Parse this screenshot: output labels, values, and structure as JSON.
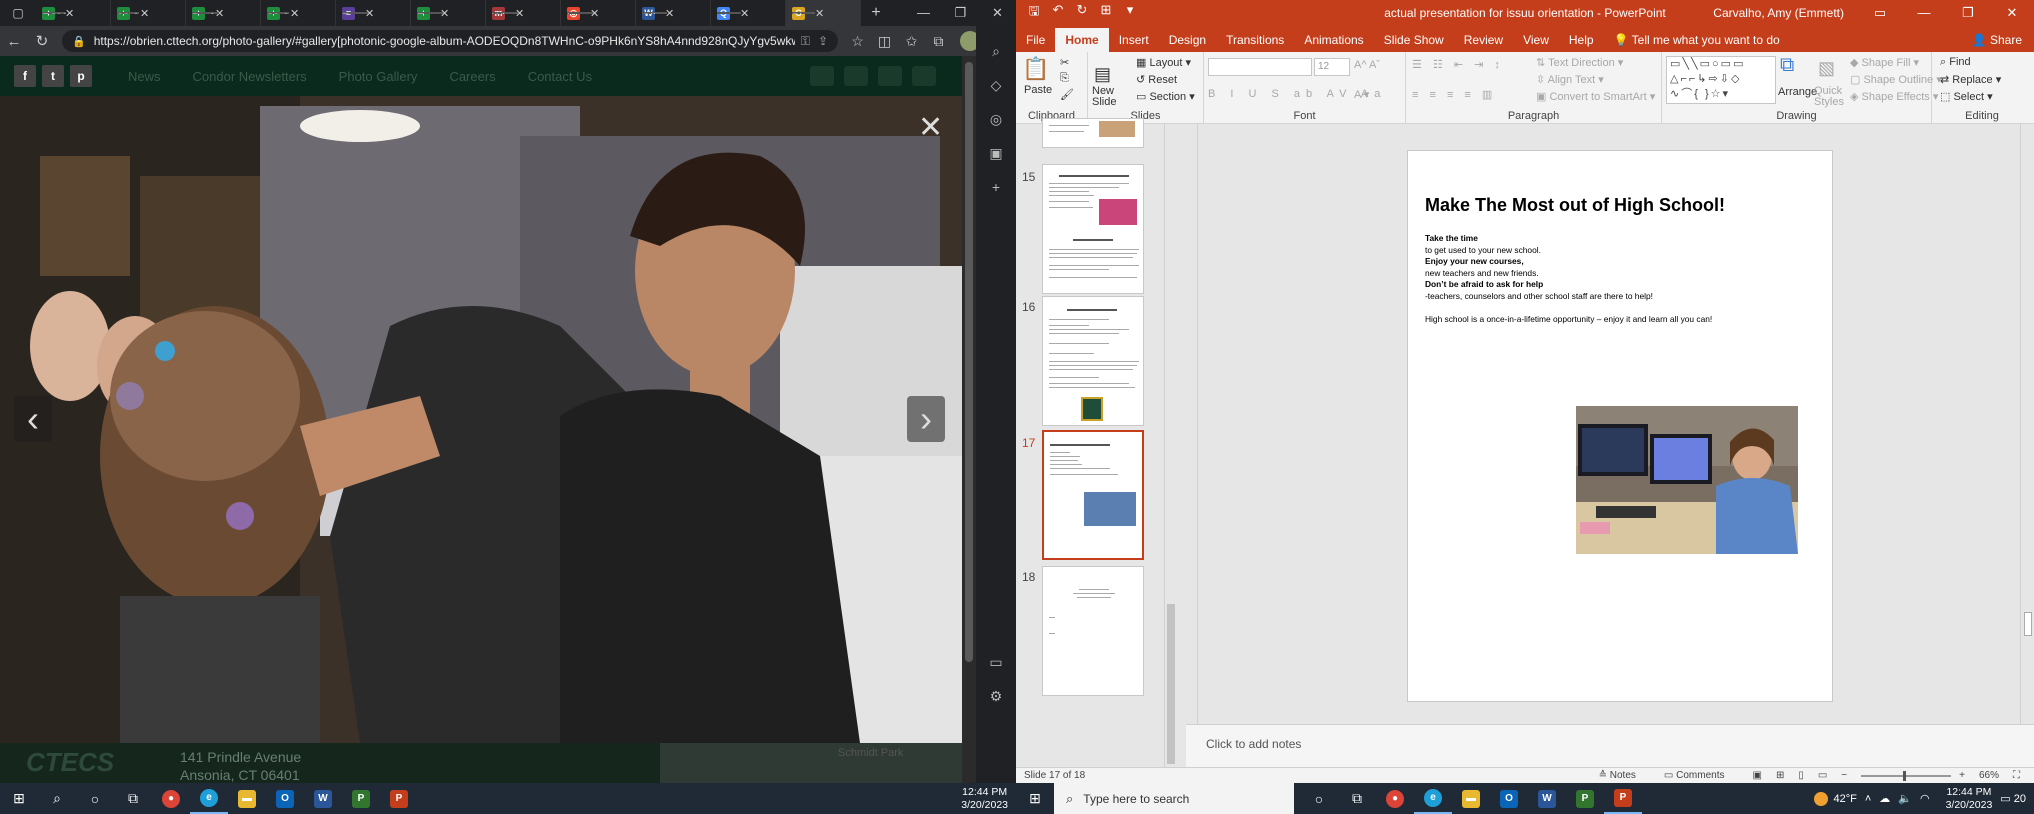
{
  "browser": {
    "tabs": [
      {
        "label": "ECM",
        "fav_color": "#1e8e3e",
        "fav_glyph": "+"
      },
      {
        "label": "22-2",
        "fav_color": "#1e8e3e",
        "fav_glyph": "+"
      },
      {
        "label": "Basic",
        "fav_color": "#1e8e3e",
        "fav_glyph": "+"
      },
      {
        "label": "23-2",
        "fav_color": "#1e8e3e",
        "fav_glyph": "+"
      },
      {
        "label": "Emm",
        "fav_color": "#5a3f9a",
        "fav_glyph": "≡"
      },
      {
        "label": "Emm",
        "fav_color": "#1e8e3e",
        "fav_glyph": "+"
      },
      {
        "label": "What",
        "fav_color": "#a4373a",
        "fav_glyph": "m"
      },
      {
        "label": "Issuu",
        "fav_color": "#e8452c",
        "fav_glyph": "◎"
      },
      {
        "label": "Olive",
        "fav_color": "#2b5797",
        "fav_glyph": "W"
      },
      {
        "label": "emm",
        "fav_color": "#4285f4",
        "fav_glyph": "Q"
      },
      {
        "label": "Phot",
        "fav_color": "#d9a520",
        "fav_glyph": "C"
      }
    ],
    "url": "https://obrien.cttech.org/photo-gallery/#gallery[photonic-google-album-AODEOQDn8TWHnC-o9PHk6nYS8hA4nnd928nQJyYgv5wkwTQa...",
    "site": {
      "nav": [
        "News",
        "Condor Newsletters",
        "Photo Gallery",
        "Careers",
        "Contact Us"
      ],
      "social": [
        "f",
        "t",
        "p"
      ],
      "footer_logo": "CTECS",
      "footer_address_line1": "141 Prindle Avenue",
      "footer_address_line2": "Ansonia, CT 06401",
      "map_label": "Schmidt Park"
    }
  },
  "ppt": {
    "window_title": "actual presentation for issuu orientation  -  PowerPoint",
    "user": "Carvalho, Amy (Emmett)",
    "tabs": [
      "File",
      "Home",
      "Insert",
      "Design",
      "Transitions",
      "Animations",
      "Slide Show",
      "Review",
      "View",
      "Help"
    ],
    "active_tab": "Home",
    "tell_me": "Tell me what you want to do",
    "share": "Share",
    "ribbon": {
      "clipboard": {
        "label": "Clipboard",
        "paste": "Paste"
      },
      "slides": {
        "label": "Slides",
        "new_slide": "New Slide",
        "layout": "Layout",
        "reset": "Reset",
        "section": "Section"
      },
      "font": {
        "label": "Font",
        "size": "12"
      },
      "paragraph": {
        "label": "Paragraph",
        "text_direction": "Text Direction",
        "align_text": "Align Text",
        "convert": "Convert to SmartArt"
      },
      "drawing": {
        "label": "Drawing",
        "arrange": "Arrange",
        "quick_styles": "Quick Styles",
        "shape_fill": "Shape Fill",
        "shape_outline": "Shape Outline",
        "shape_effects": "Shape Effects"
      },
      "editing": {
        "label": "Editing",
        "find": "Find",
        "replace": "Replace",
        "select": "Select"
      }
    },
    "thumbnails": [
      {
        "num": "15",
        "selected": false
      },
      {
        "num": "16",
        "selected": false
      },
      {
        "num": "17",
        "selected": true
      },
      {
        "num": "18",
        "selected": false
      }
    ],
    "slide": {
      "title": "Make The Most out of High School!",
      "lines": [
        {
          "text": "Take the time",
          "bold": true
        },
        {
          "text": "to get used to your new school.",
          "bold": false
        },
        {
          "text": "Enjoy your new courses,",
          "bold": true
        },
        {
          "text": "new teachers and new friends.",
          "bold": false
        },
        {
          "text": "Don’t be afraid to ask for help",
          "bold": true
        },
        {
          "text": "-teachers, counselors and other school staff are there to help!",
          "bold": false
        },
        {
          "text": "",
          "bold": false
        },
        {
          "text": "High school is a once-in-a-lifetime opportunity – enjoy it and learn all you can!",
          "bold": false
        }
      ]
    },
    "notes_placeholder": "Click to add notes",
    "status": {
      "slide_info": "Slide 17 of 18",
      "notes": "Notes",
      "comments": "Comments",
      "zoom": "66%"
    }
  },
  "taskbar": {
    "left": {
      "time": "12:44 PM",
      "date": "3/20/2023"
    },
    "right": {
      "search_placeholder": "Type here to search",
      "weather": "42°F",
      "time": "12:44 PM",
      "date": "3/20/2023",
      "notif": "20"
    }
  },
  "colors": {
    "ppt_accent": "#c43e1c",
    "browser_dark": "#202124"
  }
}
